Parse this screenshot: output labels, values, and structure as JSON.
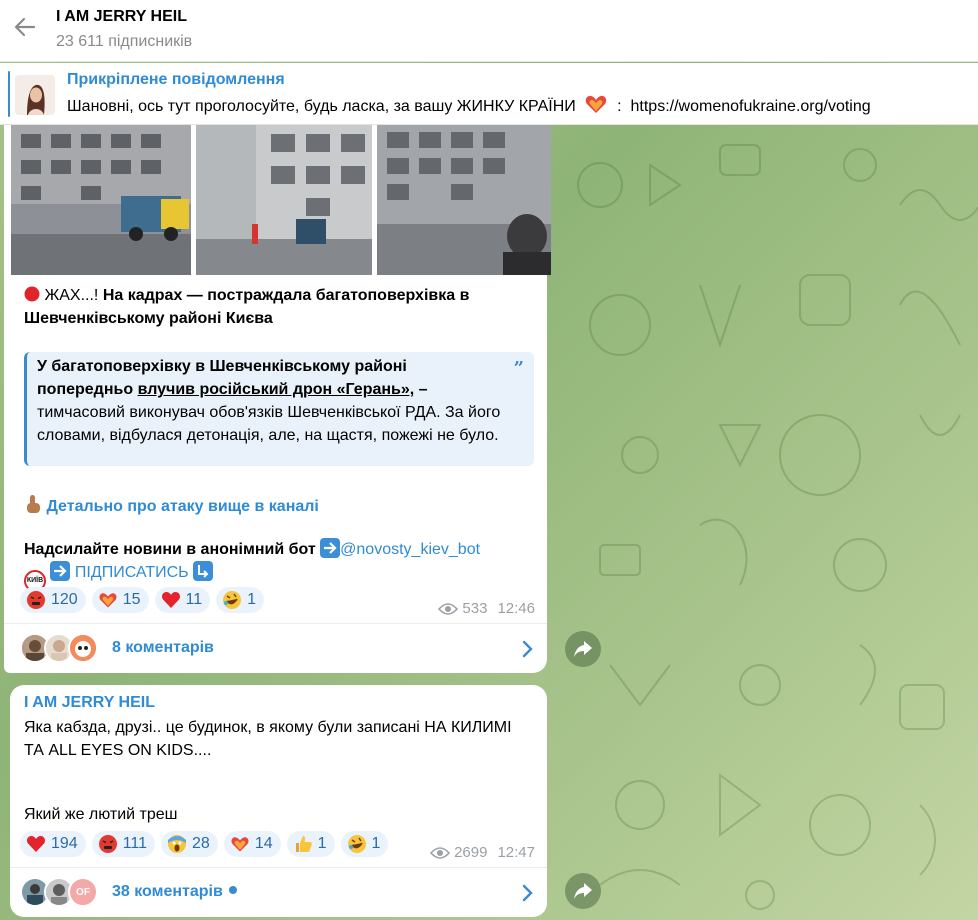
{
  "header": {
    "title": "I AM JERRY HEIL",
    "subscribers": "23 611 підписників"
  },
  "pinned": {
    "title": "Прикріплене повідомлення",
    "text": "Шановні, ось тут проголосуйте, будь ласка, за вашу ЖИНКУ КРАЇНИ",
    "link": "https://womenofukraine.org/voting"
  },
  "post1": {
    "headline_prefix": "ЖАХ...!",
    "headline": "На кадрах — постраждала багатоповерхівка в Шевченківському районі Києва",
    "quote_l1": "У багатоповерхівку в Шевченківському районі",
    "quote_l2_a": "попередньо",
    "quote_l2_link": "влучив російський дрон «Герань»,",
    "quote_l2_b": "–",
    "quote_rest": "тимчасовий виконувач обов'язків Шевченківської РДА. За його словами, відбулася детонація, але, на щастя, пожежі не було.",
    "details_link": "Детально про атаку вище в каналі",
    "bot_text": "Надсилайте новини в анонімний бот",
    "bot_handle": "@novosty_kiev_bot",
    "subscribe": "ПІДПИСАТИСЬ",
    "kyiv_badge": "КИЇВ",
    "reactions": [
      {
        "emoji": "angry-face-icon",
        "count": "120"
      },
      {
        "emoji": "heart-on-fire-icon",
        "count": "15"
      },
      {
        "emoji": "red-heart-icon",
        "count": "11"
      },
      {
        "emoji": "rofl-face-icon",
        "count": "1"
      }
    ],
    "views": "533",
    "time": "12:46",
    "comments": "8 коментарів"
  },
  "post2": {
    "sender": "I AM JERRY HEIL",
    "text_l1": "Яка кабзда, друзі.. це будинок, в якому були записані НА КИЛИМІ",
    "text_l2": "ТА ALL EYES ON KIDS....",
    "text_l3": "Який же лютий треш",
    "reactions": [
      {
        "emoji": "red-heart-icon",
        "count": "194"
      },
      {
        "emoji": "angry-face-icon",
        "count": "111"
      },
      {
        "emoji": "screaming-face-icon",
        "count": "28"
      },
      {
        "emoji": "heart-on-fire-icon",
        "count": "14"
      },
      {
        "emoji": "thumbs-up-icon",
        "count": "1"
      },
      {
        "emoji": "rofl-face-icon",
        "count": "1"
      }
    ],
    "views": "2699",
    "time": "12:47",
    "comments": "38 коментарів",
    "avatar3_initials": "OF"
  }
}
